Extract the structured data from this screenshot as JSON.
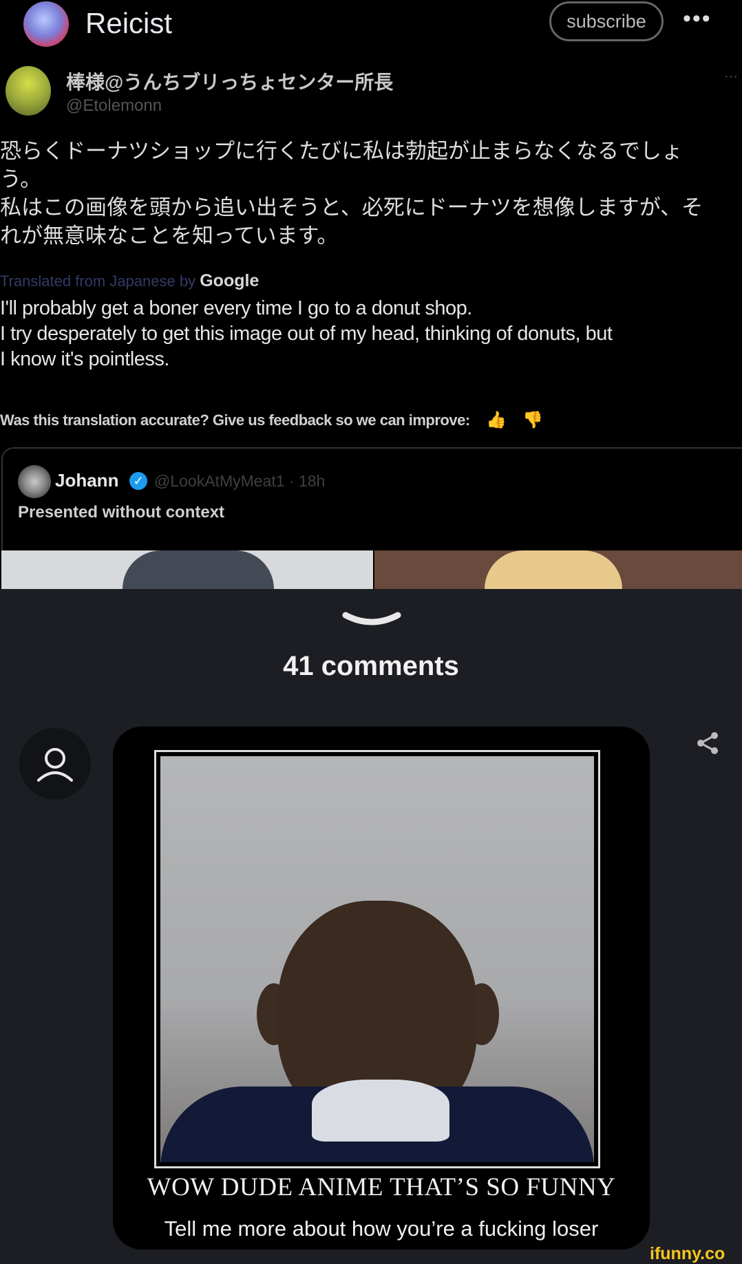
{
  "header": {
    "channel_name": "Reicist",
    "subscribe_label": "subscribe",
    "more_label": "•••"
  },
  "tweet": {
    "author_name": "棒様@うんちブリっちょセンター所長",
    "author_handle": "@Etolemonn",
    "more_label": "···",
    "japanese_lines": [
      "恐らくドーナツショップに行くたびに私は勃起が止まらなくなるでしょ",
      "う。",
      "私はこの画像を頭から追い出そうと、必死にドーナツを想像しますが、そ",
      "れが無意味なことを知っています。"
    ],
    "translated_note": "Translated from Japanese by",
    "translator": "Google",
    "english_lines": [
      "I'll probably get a boner every time I go to a donut shop.",
      "I try desperately to get this image out of my head, thinking of donuts, but",
      "I know it's pointless."
    ],
    "feedback_text": "Was this translation accurate? Give us feedback so we can improve:",
    "thumbs_up_icon": "👍",
    "thumbs_down_icon": "👎"
  },
  "quoted_tweet": {
    "author_name": "Johann",
    "verified_mark": "✓",
    "author_meta": "@LookAtMyMeat1 · 18h",
    "text": "Presented without context"
  },
  "comments": {
    "count_label": "41 comments"
  },
  "meme": {
    "caption_title": "WOW DUDE ANIME THAT’S SO FUNNY",
    "caption_subtitle": "Tell me more about how you’re a fucking loser"
  },
  "watermark": "ifunny.co",
  "colors": {
    "post_background": "#000000",
    "page_background": "#1c1e24",
    "verified_blue": "#1d9bf0",
    "watermark_yellow": "#f5c61e"
  }
}
